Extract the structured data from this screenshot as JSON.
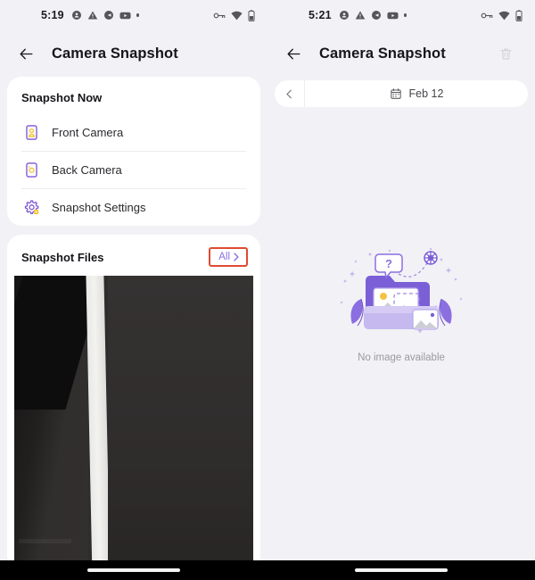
{
  "left": {
    "status_bar": {
      "time": "5:19",
      "left_icons": [
        "privacy-badge-icon",
        "warning-triangle-icon",
        "message-bubble-icon",
        "youtube-icon",
        "more-dot-icon"
      ],
      "right_icons": [
        "vpn-key-icon",
        "wifi-icon",
        "battery-icon"
      ]
    },
    "appbar": {
      "back_icon": "arrow-left-icon",
      "title": "Camera Snapshot"
    },
    "snapshot_now": {
      "title": "Snapshot Now",
      "items": [
        {
          "label": "Front Camera",
          "icon": "front-camera-icon"
        },
        {
          "label": "Back Camera",
          "icon": "back-camera-icon"
        },
        {
          "label": "Snapshot Settings",
          "icon": "snapshot-settings-gear-icon"
        }
      ]
    },
    "snapshot_files": {
      "title": "Snapshot Files",
      "all_label": "All",
      "all_chevron_icon": "chevron-right-icon",
      "highlight_color": "#e04a32",
      "accent_color": "#8b6fe0"
    }
  },
  "right": {
    "status_bar": {
      "time": "5:21",
      "left_icons": [
        "privacy-badge-icon",
        "warning-triangle-icon",
        "message-bubble-icon",
        "youtube-icon",
        "more-dot-icon"
      ],
      "right_icons": [
        "vpn-key-icon",
        "wifi-icon",
        "battery-icon"
      ]
    },
    "appbar": {
      "back_icon": "arrow-left-icon",
      "title": "Camera Snapshot",
      "delete_icon": "trash-icon"
    },
    "date_bar": {
      "prev_icon": "chevron-left-icon",
      "calendar_icon": "calendar-icon",
      "date": "Feb 12"
    },
    "empty_state": {
      "illustration": "empty-folder-photos-illustration",
      "message": "No image available"
    }
  }
}
